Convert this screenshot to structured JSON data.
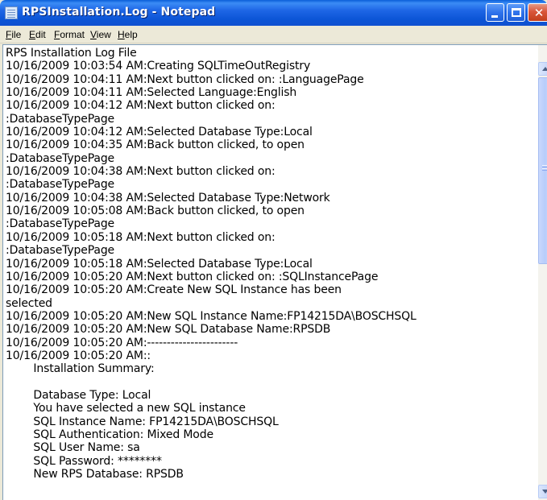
{
  "window": {
    "title": "RPSInstallation.Log - Notepad",
    "icon": "notepad-icon",
    "controls": {
      "minimize": "minimize-icon",
      "maximize": "maximize-icon",
      "close_glyph": "✕"
    }
  },
  "menu": {
    "file": "File",
    "edit": "Edit",
    "format": "Format",
    "view": "View",
    "help": "Help"
  },
  "editor": {
    "text": "RPS Installation Log File\n10/16/2009 10:03:54 AM:Creating SQLTimeOutRegistry\n10/16/2009 10:04:11 AM:Next button clicked on: :LanguagePage\n10/16/2009 10:04:11 AM:Selected Language:English\n10/16/2009 10:04:12 AM:Next button clicked on:\n:DatabaseTypePage\n10/16/2009 10:04:12 AM:Selected Database Type:Local\n10/16/2009 10:04:35 AM:Back button clicked, to open\n:DatabaseTypePage\n10/16/2009 10:04:38 AM:Next button clicked on:\n:DatabaseTypePage\n10/16/2009 10:04:38 AM:Selected Database Type:Network\n10/16/2009 10:05:08 AM:Back button clicked, to open\n:DatabaseTypePage\n10/16/2009 10:05:18 AM:Next button clicked on:\n:DatabaseTypePage\n10/16/2009 10:05:18 AM:Selected Database Type:Local\n10/16/2009 10:05:20 AM:Next button clicked on: :SQLInstancePage\n10/16/2009 10:05:20 AM:Create New SQL Instance has been\nselected\n10/16/2009 10:05:20 AM:New SQL Instance Name:FP14215DA\\BOSCHSQL\n10/16/2009 10:05:20 AM:New SQL Database Name:RPSDB\n10/16/2009 10:05:20 AM:-----------------------\n10/16/2009 10:05:20 AM::\n        Installation Summary:\n\n        Database Type: Local\n        You have selected a new SQL instance\n        SQL Instance Name: FP14215DA\\BOSCHSQL\n        SQL Authentication: Mixed Mode\n        SQL User Name: sa\n        SQL Password: ********\n        New RPS Database: RPSDB"
  },
  "scrollbar": {
    "up_icon": "scroll-up-arrow-icon",
    "down_icon": "scroll-down-arrow-icon"
  }
}
